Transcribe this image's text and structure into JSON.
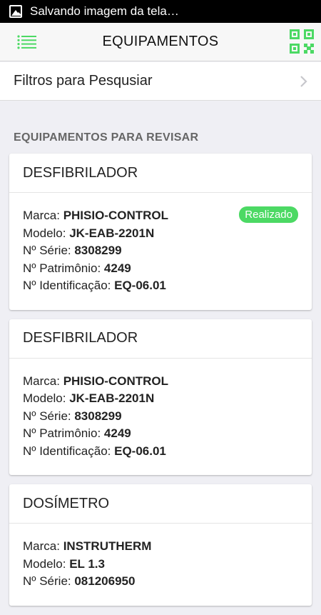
{
  "status_bar": {
    "text": "Salvando imagem da tela…"
  },
  "nav": {
    "title": "EQUIPAMENTOS"
  },
  "filter": {
    "label": "Filtros para Pesqusiar"
  },
  "section": {
    "title": "EQUIPAMENTOS PARA REVISAR"
  },
  "labels": {
    "marca": "Marca: ",
    "modelo": "Modelo: ",
    "serie": "Nº Série: ",
    "patrimonio": "Nº Patrimônio: ",
    "identificacao": "Nº Identificação: "
  },
  "colors": {
    "accent": "#4cd964",
    "badge": "#4cd964"
  },
  "cards": [
    {
      "name": "DESFIBRILADOR",
      "marca": "PHISIO-CONTROL",
      "modelo": "JK-EAB-2201N",
      "serie": "8308299",
      "patrimonio": "4249",
      "identificacao": "EQ-06.01",
      "status": "Realizado"
    },
    {
      "name": "DESFIBRILADOR",
      "marca": "PHISIO-CONTROL",
      "modelo": "JK-EAB-2201N",
      "serie": "8308299",
      "patrimonio": "4249",
      "identificacao": "EQ-06.01"
    },
    {
      "name": "DOSÍMETRO",
      "marca": "INSTRUTHERM",
      "modelo": "EL 1.3",
      "serie": "081206950"
    }
  ]
}
